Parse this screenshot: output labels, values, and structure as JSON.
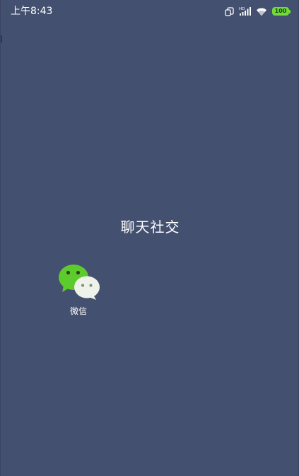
{
  "status_bar": {
    "time": "上午8:43",
    "battery_level": "100",
    "network_label": "HD",
    "icons": [
      "dual-sim-icon",
      "signal-hd-icon",
      "wifi-icon",
      "battery-icon"
    ]
  },
  "folder": {
    "title": "聊天社交",
    "apps": [
      {
        "label": "微信",
        "icon": "wechat-icon"
      }
    ]
  },
  "colors": {
    "background": "#44506f",
    "battery": "#6fdc3a",
    "wechat_green": "#5ccb2b",
    "wechat_white": "#eef2ea"
  }
}
